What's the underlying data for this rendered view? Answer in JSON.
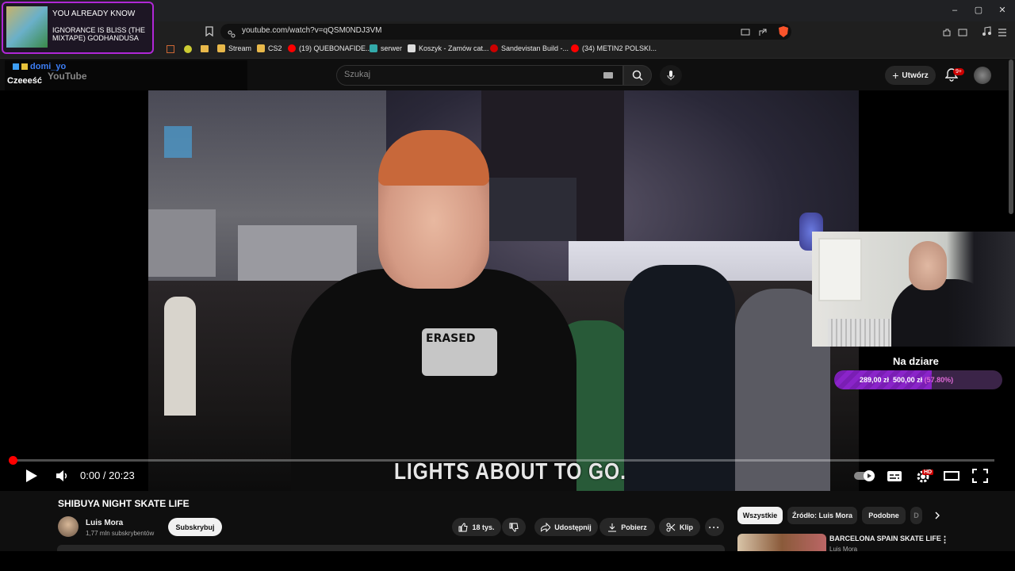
{
  "browser": {
    "url": "youtube.com/watch?v=qQSM0NDJ3VM",
    "window_controls": [
      "–",
      "▢",
      "✕"
    ],
    "bookmarks": [
      {
        "label": "Stream",
        "color": "#e8b84a"
      },
      {
        "label": "CS2",
        "color": "#e8b84a"
      },
      {
        "label": "(19) QUEBONAFIDE...",
        "color": "#ff0000"
      },
      {
        "label": "serwer",
        "color": "#3aa"
      },
      {
        "label": "Koszyk - Zamów cat...",
        "color": "#ddd"
      },
      {
        "label": "Sandevistan Build -...",
        "color": "#c00"
      },
      {
        "label": "(34) METIN2 POLSKI...",
        "color": "#ff0000"
      }
    ]
  },
  "music_overlay": {
    "line1": "YOU ALREADY KNOW",
    "line2": "IGNORANCE IS BLISS (THE MIXTAPE) GODHANDUSA"
  },
  "chat_overlay": {
    "username": "domi_yo",
    "message": "Czeeeść",
    "logo_text": "YouTube"
  },
  "youtube_header": {
    "search_placeholder": "Szukaj",
    "create_label": "Utwórz",
    "notification_badge": "9+"
  },
  "player": {
    "time": "0:00 / 20:23",
    "subtitle": "LIGHTS ABOUT TO GO.",
    "progress": 0.0,
    "quality_badge": "HD",
    "shirt_text": "ERASED"
  },
  "donation": {
    "title": "Na dziare",
    "current": "289,00 zł",
    "goal": "500,00 zł",
    "percent_text": "(57.80%)",
    "progress": 0.578
  },
  "video_info": {
    "title": "SHIBUYA NIGHT SKATE LIFE",
    "channel": "Luis Mora",
    "subscribers": "1,77 mln subskrybentów",
    "subscribe_label": "Subskrybuj",
    "likes": "18 tys.",
    "share_label": "Udostępnij",
    "download_label": "Pobierz",
    "clip_label": "Klip"
  },
  "sidebar": {
    "chips": [
      "Wszystkie",
      "Źródło: Luis Mora",
      "Podobne",
      "D"
    ],
    "recommendation": {
      "title": "BARCELONA SPAIN SKATE LIFE",
      "channel": "Luis Mora"
    }
  }
}
